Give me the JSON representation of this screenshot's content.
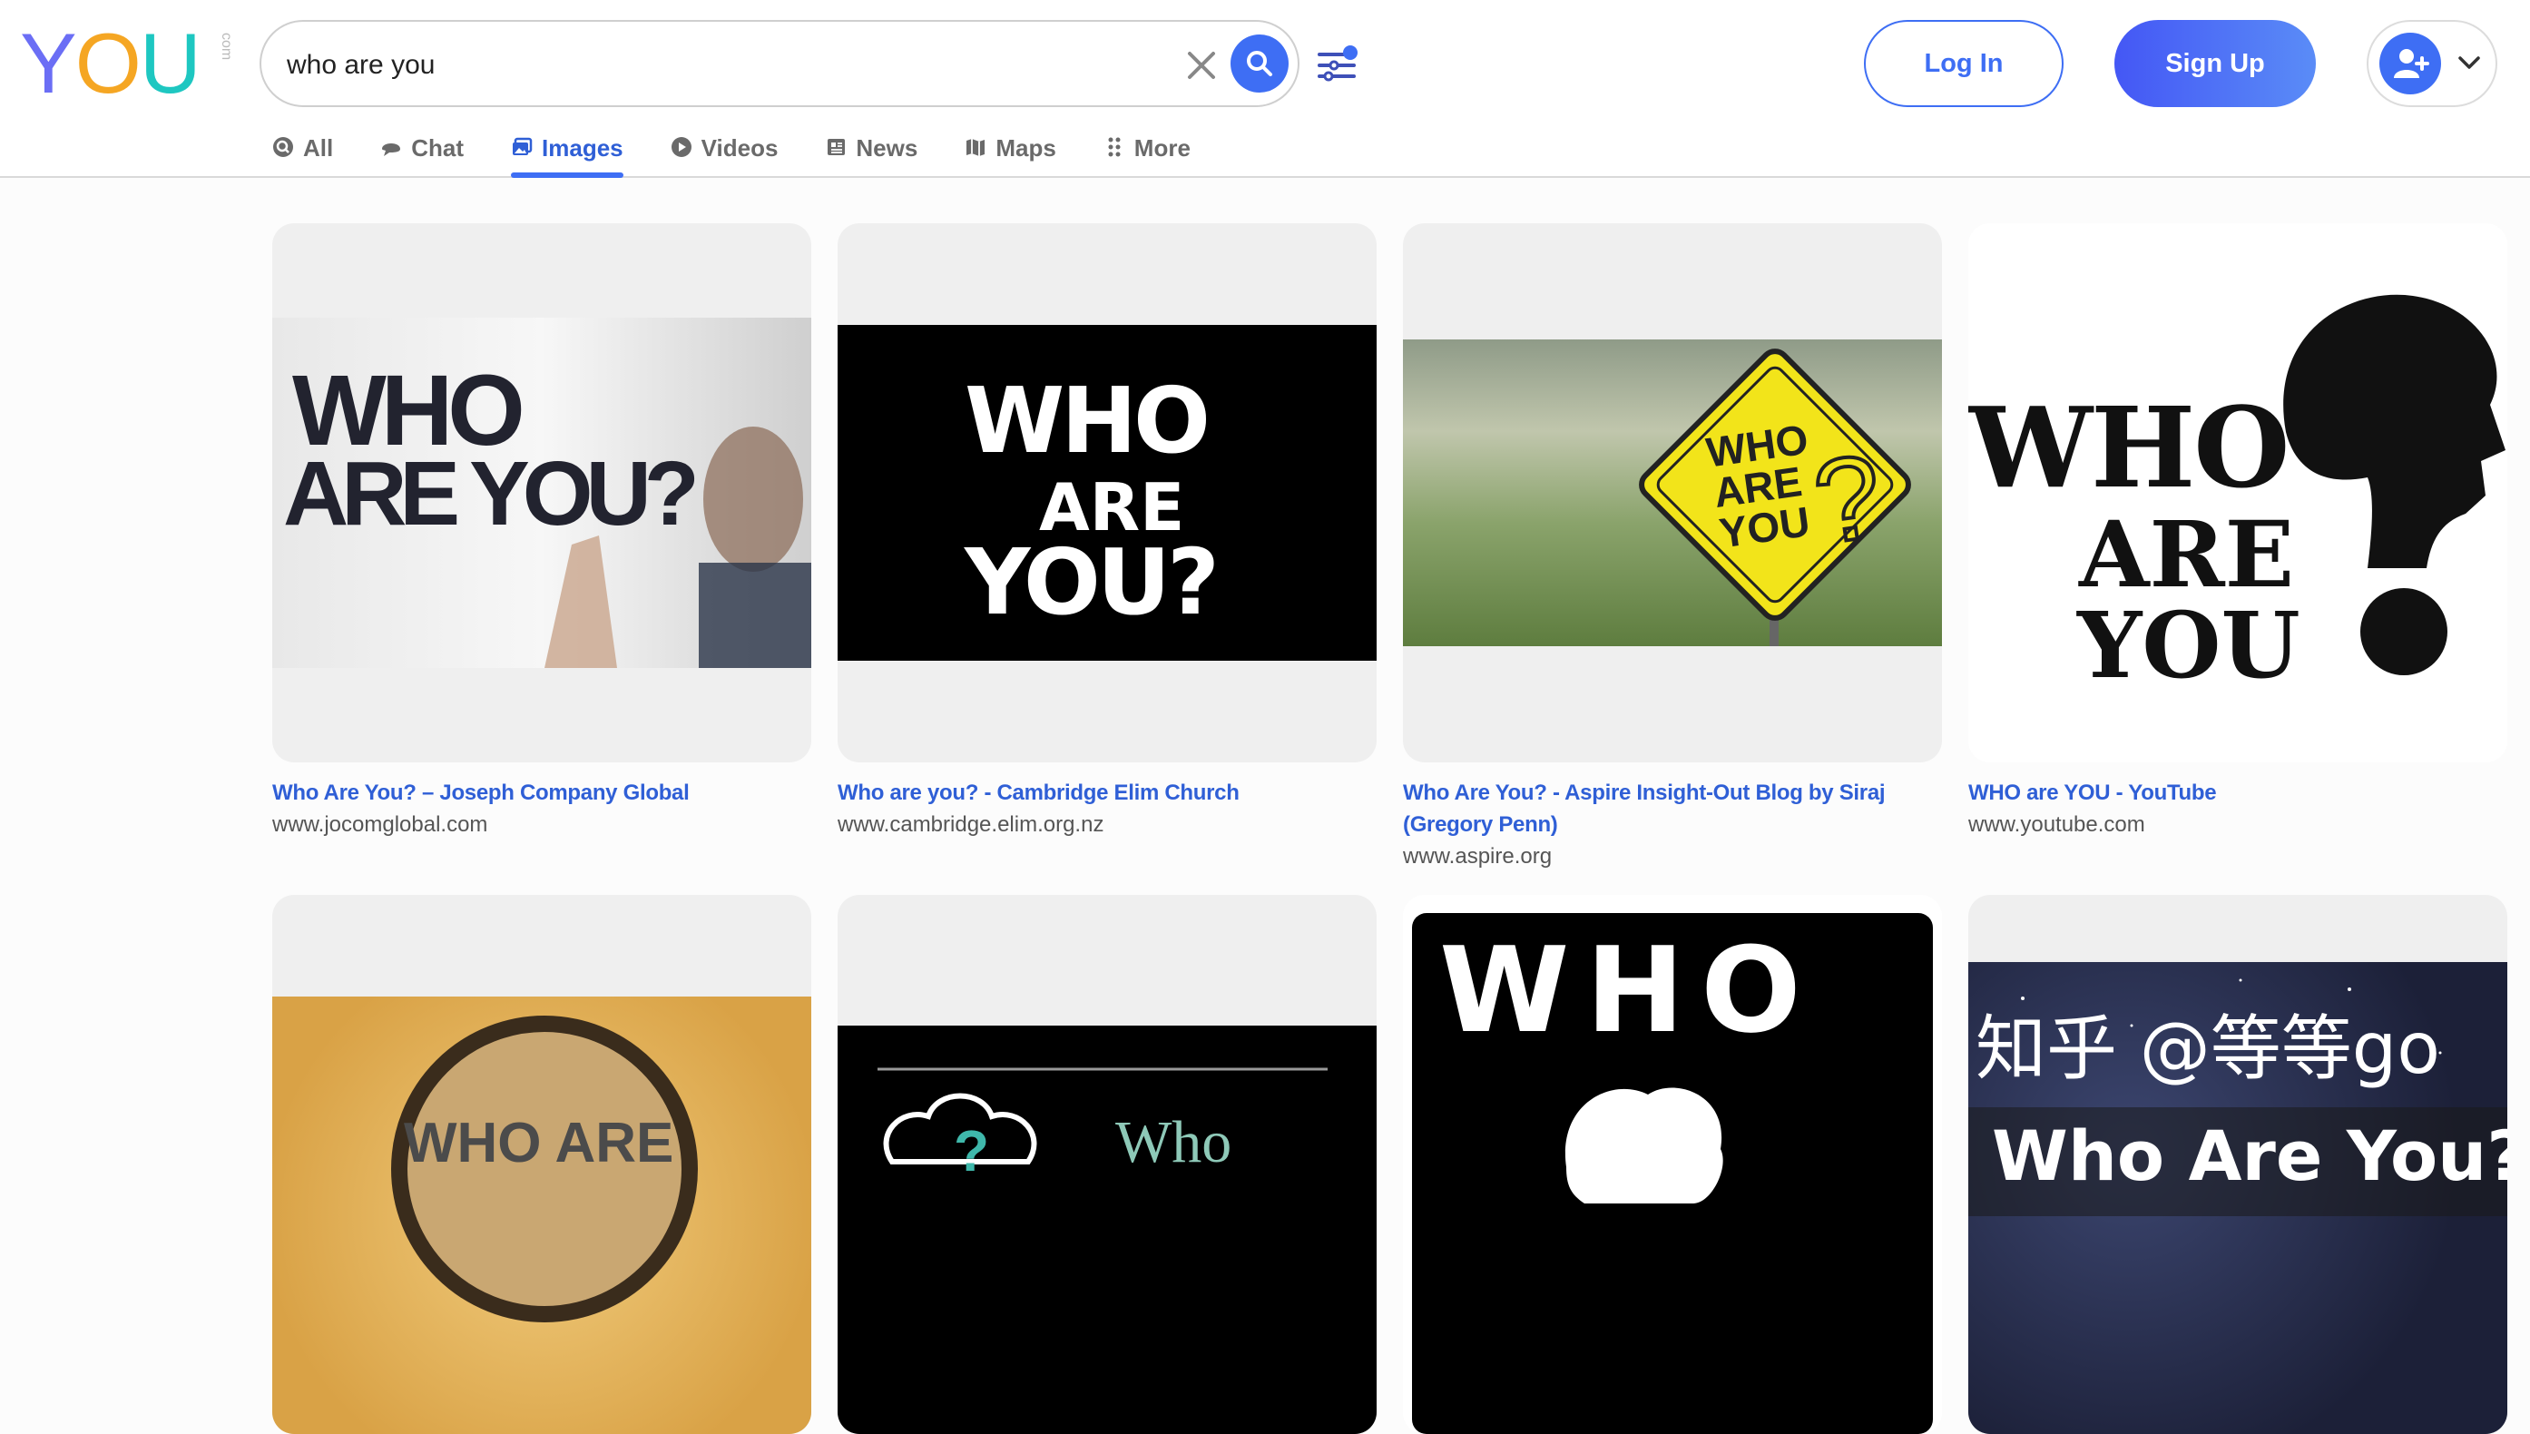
{
  "brand": {
    "logo_y": "Y",
    "logo_o": "O",
    "logo_u": "U",
    "logo_suffix": "com",
    "color_y": "#6b6ef5",
    "color_o": "#f5a623",
    "color_u": "#1ec7c1"
  },
  "search": {
    "query": "who are you",
    "placeholder": ""
  },
  "header": {
    "login_label": "Log In",
    "signup_label": "Sign Up",
    "accent": "#3e6ef4"
  },
  "tabs": [
    {
      "label": "All",
      "icon": "all-icon",
      "active": false
    },
    {
      "label": "Chat",
      "icon": "chat-icon",
      "active": false
    },
    {
      "label": "Images",
      "icon": "images-icon",
      "active": true
    },
    {
      "label": "Videos",
      "icon": "play-icon",
      "active": false
    },
    {
      "label": "News",
      "icon": "newspaper-icon",
      "active": false
    },
    {
      "label": "Maps",
      "icon": "map-icon",
      "active": false
    },
    {
      "label": "More",
      "icon": "dots-grid-icon",
      "active": false
    }
  ],
  "results": [
    {
      "title": "Who Are You? – Joseph Company Global",
      "source": "www.jocomglobal.com",
      "image_text": "WHO ARE YOU?"
    },
    {
      "title": "Who are you? - Cambridge Elim Church",
      "source": "www.cambridge.elim.org.nz",
      "image_text": "WHO ARE YOU?"
    },
    {
      "title": "Who Are You? - Aspire Insight-Out Blog by Siraj (Gregory Penn)",
      "source": "www.aspire.org",
      "image_text": "WHO ARE YOU ?"
    },
    {
      "title": "WHO are YOU - YouTube",
      "source": "www.youtube.com",
      "image_text": "WHO ARE YOU"
    },
    {
      "title": "",
      "source": "",
      "image_text": "WHO ARE"
    },
    {
      "title": "",
      "source": "",
      "image_text": "Who"
    },
    {
      "title": "",
      "source": "",
      "image_text": "WHO"
    },
    {
      "title": "",
      "source": "",
      "image_text": "知乎 @等等go",
      "image_text_2": "Who Are You?"
    }
  ]
}
